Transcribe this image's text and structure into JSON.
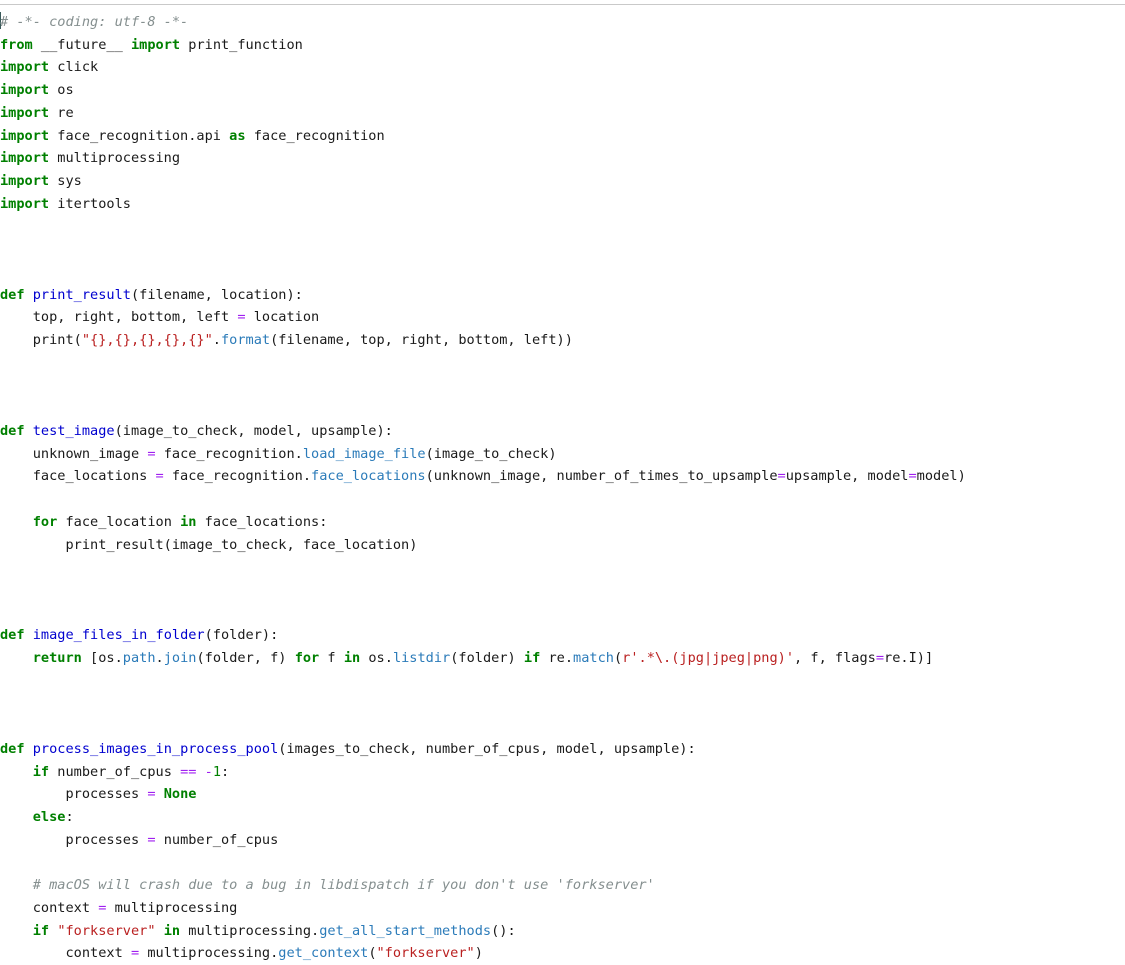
{
  "editor": {
    "language": "Python",
    "background_color": "#ffffff",
    "top_rule_color": "#c9c9c9",
    "caret_visible": true,
    "caret_line": 1,
    "caret_column": 0,
    "font_size_px": 13.6,
    "line_height_px": 22.72
  },
  "syntax_colors": {
    "keyword": "#008000",
    "keyword_constant": "#008000",
    "comment": "#858f8f",
    "function_def_name": "#0000cf",
    "method_call": "#2b7bb9",
    "string": "#ba2121",
    "operator": "#a020f0",
    "number": "#008000",
    "plain_text": "#1a1a1a"
  },
  "code": {
    "lines": [
      [
        {
          "t": "c",
          "v": "# -*- coding: utf-8 -*-"
        }
      ],
      [
        {
          "t": "k",
          "v": "from"
        },
        {
          "t": "n",
          "v": " __future__ "
        },
        {
          "t": "k",
          "v": "import"
        },
        {
          "t": "n",
          "v": " print_function"
        }
      ],
      [
        {
          "t": "k",
          "v": "import"
        },
        {
          "t": "n",
          "v": " click"
        }
      ],
      [
        {
          "t": "k",
          "v": "import"
        },
        {
          "t": "n",
          "v": " os"
        }
      ],
      [
        {
          "t": "k",
          "v": "import"
        },
        {
          "t": "n",
          "v": " re"
        }
      ],
      [
        {
          "t": "k",
          "v": "import"
        },
        {
          "t": "n",
          "v": " face_recognition.api "
        },
        {
          "t": "k",
          "v": "as"
        },
        {
          "t": "n",
          "v": " face_recognition"
        }
      ],
      [
        {
          "t": "k",
          "v": "import"
        },
        {
          "t": "n",
          "v": " multiprocessing"
        }
      ],
      [
        {
          "t": "k",
          "v": "import"
        },
        {
          "t": "n",
          "v": " sys"
        }
      ],
      [
        {
          "t": "k",
          "v": "import"
        },
        {
          "t": "n",
          "v": " itertools"
        }
      ],
      [],
      [],
      [],
      [
        {
          "t": "k",
          "v": "def"
        },
        {
          "t": "n",
          "v": " "
        },
        {
          "t": "nf",
          "v": "print_result"
        },
        {
          "t": "n",
          "v": "(filename, location):"
        }
      ],
      [
        {
          "t": "n",
          "v": "    top, right, bottom, left "
        },
        {
          "t": "o",
          "v": "="
        },
        {
          "t": "n",
          "v": " location"
        }
      ],
      [
        {
          "t": "n",
          "v": "    print("
        },
        {
          "t": "s",
          "v": "\"{},{},{},{},{}\""
        },
        {
          "t": "n",
          "v": "."
        },
        {
          "t": "nm",
          "v": "format"
        },
        {
          "t": "n",
          "v": "(filename, top, right, bottom, left))"
        }
      ],
      [],
      [],
      [],
      [
        {
          "t": "k",
          "v": "def"
        },
        {
          "t": "n",
          "v": " "
        },
        {
          "t": "nf",
          "v": "test_image"
        },
        {
          "t": "n",
          "v": "(image_to_check, model, upsample):"
        }
      ],
      [
        {
          "t": "n",
          "v": "    unknown_image "
        },
        {
          "t": "o",
          "v": "="
        },
        {
          "t": "n",
          "v": " face_recognition."
        },
        {
          "t": "nm",
          "v": "load_image_file"
        },
        {
          "t": "n",
          "v": "(image_to_check)"
        }
      ],
      [
        {
          "t": "n",
          "v": "    face_locations "
        },
        {
          "t": "o",
          "v": "="
        },
        {
          "t": "n",
          "v": " face_recognition."
        },
        {
          "t": "nm",
          "v": "face_locations"
        },
        {
          "t": "n",
          "v": "(unknown_image, number_of_times_to_upsample"
        },
        {
          "t": "o",
          "v": "="
        },
        {
          "t": "n",
          "v": "upsample, model"
        },
        {
          "t": "o",
          "v": "="
        },
        {
          "t": "n",
          "v": "model)"
        }
      ],
      [],
      [
        {
          "t": "n",
          "v": "    "
        },
        {
          "t": "k",
          "v": "for"
        },
        {
          "t": "n",
          "v": " face_location "
        },
        {
          "t": "k",
          "v": "in"
        },
        {
          "t": "n",
          "v": " face_locations:"
        }
      ],
      [
        {
          "t": "n",
          "v": "        print_result(image_to_check, face_location)"
        }
      ],
      [],
      [],
      [],
      [
        {
          "t": "k",
          "v": "def"
        },
        {
          "t": "n",
          "v": " "
        },
        {
          "t": "nf",
          "v": "image_files_in_folder"
        },
        {
          "t": "n",
          "v": "(folder):"
        }
      ],
      [
        {
          "t": "n",
          "v": "    "
        },
        {
          "t": "k",
          "v": "return"
        },
        {
          "t": "n",
          "v": " [os."
        },
        {
          "t": "nm",
          "v": "path"
        },
        {
          "t": "n",
          "v": "."
        },
        {
          "t": "nm",
          "v": "join"
        },
        {
          "t": "n",
          "v": "(folder, f) "
        },
        {
          "t": "k",
          "v": "for"
        },
        {
          "t": "n",
          "v": " f "
        },
        {
          "t": "k",
          "v": "in"
        },
        {
          "t": "n",
          "v": " os."
        },
        {
          "t": "nm",
          "v": "listdir"
        },
        {
          "t": "n",
          "v": "(folder) "
        },
        {
          "t": "k",
          "v": "if"
        },
        {
          "t": "n",
          "v": " re."
        },
        {
          "t": "nm",
          "v": "match"
        },
        {
          "t": "n",
          "v": "("
        },
        {
          "t": "s",
          "v": "r'.*\\.(jpg|jpeg|png)'"
        },
        {
          "t": "n",
          "v": ", f, flags"
        },
        {
          "t": "o",
          "v": "="
        },
        {
          "t": "n",
          "v": "re.I)]"
        }
      ],
      [],
      [],
      [],
      [
        {
          "t": "k",
          "v": "def"
        },
        {
          "t": "n",
          "v": " "
        },
        {
          "t": "nf",
          "v": "process_images_in_process_pool"
        },
        {
          "t": "n",
          "v": "(images_to_check, number_of_cpus, model, upsample):"
        }
      ],
      [
        {
          "t": "n",
          "v": "    "
        },
        {
          "t": "k",
          "v": "if"
        },
        {
          "t": "n",
          "v": " number_of_cpus "
        },
        {
          "t": "o",
          "v": "=="
        },
        {
          "t": "n",
          "v": " "
        },
        {
          "t": "o",
          "v": "-"
        },
        {
          "t": "mi",
          "v": "1"
        },
        {
          "t": "n",
          "v": ":"
        }
      ],
      [
        {
          "t": "n",
          "v": "        processes "
        },
        {
          "t": "o",
          "v": "="
        },
        {
          "t": "n",
          "v": " "
        },
        {
          "t": "kc",
          "v": "None"
        }
      ],
      [
        {
          "t": "n",
          "v": "    "
        },
        {
          "t": "k",
          "v": "else"
        },
        {
          "t": "n",
          "v": ":"
        }
      ],
      [
        {
          "t": "n",
          "v": "        processes "
        },
        {
          "t": "o",
          "v": "="
        },
        {
          "t": "n",
          "v": " number_of_cpus"
        }
      ],
      [],
      [
        {
          "t": "n",
          "v": "    "
        },
        {
          "t": "c",
          "v": "# macOS will crash due to a bug in libdispatch if you don't use 'forkserver'"
        }
      ],
      [
        {
          "t": "n",
          "v": "    context "
        },
        {
          "t": "o",
          "v": "="
        },
        {
          "t": "n",
          "v": " multiprocessing"
        }
      ],
      [
        {
          "t": "n",
          "v": "    "
        },
        {
          "t": "k",
          "v": "if"
        },
        {
          "t": "n",
          "v": " "
        },
        {
          "t": "s",
          "v": "\"forkserver\""
        },
        {
          "t": "n",
          "v": " "
        },
        {
          "t": "k",
          "v": "in"
        },
        {
          "t": "n",
          "v": " multiprocessing."
        },
        {
          "t": "nm",
          "v": "get_all_start_methods"
        },
        {
          "t": "n",
          "v": "():"
        }
      ],
      [
        {
          "t": "n",
          "v": "        context "
        },
        {
          "t": "o",
          "v": "="
        },
        {
          "t": "n",
          "v": " multiprocessing."
        },
        {
          "t": "nm",
          "v": "get_context"
        },
        {
          "t": "n",
          "v": "("
        },
        {
          "t": "s",
          "v": "\"forkserver\""
        },
        {
          "t": "n",
          "v": ")"
        }
      ]
    ]
  }
}
